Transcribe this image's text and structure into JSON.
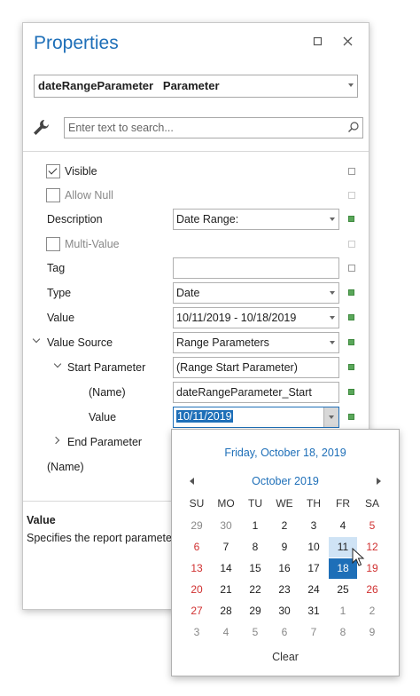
{
  "panel": {
    "title": "Properties",
    "restore_icon": "restore-icon",
    "close_icon": "close-icon",
    "object_selector": {
      "name": "dateRangeParameter",
      "type": "Parameter"
    },
    "search": {
      "placeholder": "Enter text to search..."
    }
  },
  "properties": {
    "visible": {
      "label": "Visible",
      "checked": true
    },
    "allow_null": {
      "label": "Allow Null",
      "checked": false
    },
    "description": {
      "label": "Description",
      "value": "Date Range:"
    },
    "multi_value": {
      "label": "Multi-Value",
      "checked": false
    },
    "tag": {
      "label": "Tag",
      "value": ""
    },
    "type": {
      "label": "Type",
      "value": "Date"
    },
    "value": {
      "label": "Value",
      "value": "10/11/2019 - 10/18/2019"
    },
    "value_source": {
      "label": "Value Source",
      "value": "Range Parameters"
    },
    "start_parameter": {
      "label": "Start Parameter",
      "value": "(Range Start Parameter)"
    },
    "start_name": {
      "label": "(Name)",
      "value": "dateRangeParameter_Start"
    },
    "start_value": {
      "label": "Value",
      "value": "10/11/2019"
    },
    "end_parameter": {
      "label": "End Parameter"
    },
    "name": {
      "label": "(Name)"
    }
  },
  "description_panel": {
    "title": "Value",
    "text": "Specifies the report parameter's"
  },
  "calendar": {
    "today_text": "Friday, October 18, 2019",
    "month_label": "October 2019",
    "day_names": [
      "SU",
      "MO",
      "TU",
      "WE",
      "TH",
      "FR",
      "SA"
    ],
    "weeks": [
      [
        "29",
        "30",
        "1",
        "2",
        "3",
        "4",
        "5"
      ],
      [
        "6",
        "7",
        "8",
        "9",
        "10",
        "11",
        "12"
      ],
      [
        "13",
        "14",
        "15",
        "16",
        "17",
        "18",
        "19"
      ],
      [
        "20",
        "21",
        "22",
        "23",
        "24",
        "25",
        "26"
      ],
      [
        "27",
        "28",
        "29",
        "30",
        "31",
        "1",
        "2"
      ],
      [
        "3",
        "4",
        "5",
        "6",
        "7",
        "8",
        "9"
      ]
    ],
    "hovered_day": "11",
    "selected_day": "18",
    "clear_label": "Clear"
  },
  "colors": {
    "accent": "#1e6fb8",
    "weekend": "#d03030",
    "marker_green": "#5aa75a"
  }
}
